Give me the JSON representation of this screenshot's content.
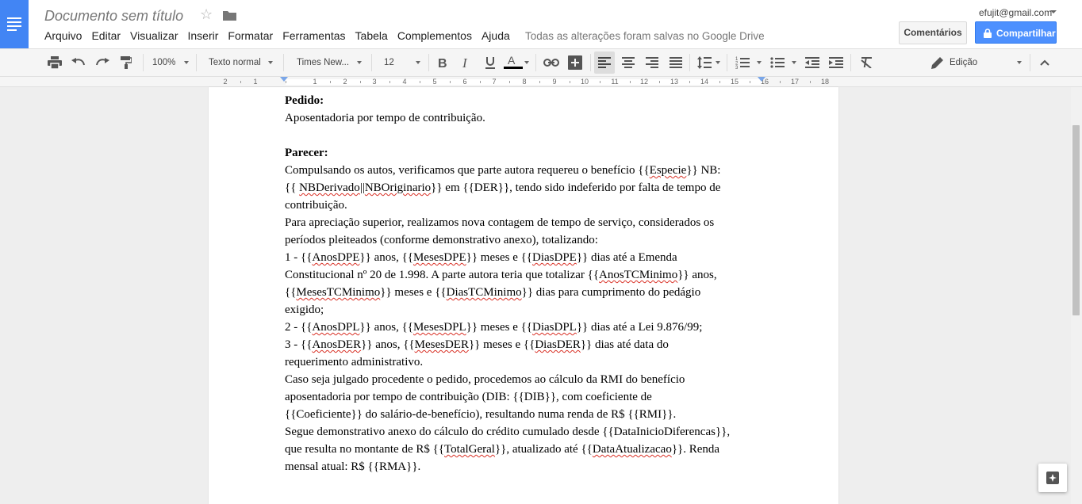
{
  "app": {
    "title": "Documento sem título",
    "save_status": "Todas as alterações foram salvas no Google Drive",
    "account_email": "efujit@gmail.com",
    "brand_color": "#4285f4"
  },
  "menu": [
    "Arquivo",
    "Editar",
    "Visualizar",
    "Inserir",
    "Formatar",
    "Ferramentas",
    "Tabela",
    "Complementos",
    "Ajuda"
  ],
  "header_buttons": {
    "comments": "Comentários",
    "share": "Compartilhar"
  },
  "toolbar": {
    "zoom": "100%",
    "style": "Texto normal",
    "font": "Times New...",
    "size": "12",
    "mode": "Edição",
    "icons": [
      "print-icon",
      "undo-icon",
      "redo-icon",
      "paint-format-icon",
      "bold-icon",
      "italic-icon",
      "underline-icon",
      "text-color-icon",
      "link-icon",
      "comment-icon",
      "align-left-icon",
      "align-center-icon",
      "align-right-icon",
      "justify-icon",
      "line-spacing-icon",
      "numbered-list-icon",
      "bulleted-list-icon",
      "decrease-indent-icon",
      "increase-indent-icon",
      "clear-formatting-icon",
      "pencil-icon",
      "chevron-up-icon"
    ]
  },
  "ruler": {
    "labels": [
      "2",
      "1",
      "1",
      "2",
      "3",
      "4",
      "5",
      "6",
      "7",
      "8",
      "9",
      "10",
      "11",
      "12",
      "13",
      "14",
      "15",
      "16",
      "17",
      "18"
    ]
  },
  "document": {
    "lines": [
      [
        {
          "t": "Pedido:",
          "b": true
        }
      ],
      [
        {
          "t": "Aposentadoria por tempo de contribuição."
        }
      ],
      [],
      [
        {
          "t": "Parecer:",
          "b": true
        }
      ],
      [
        {
          "t": "Compulsando os autos, verificamos que parte autora requereu o benefício {{"
        },
        {
          "t": "Especie",
          "s": true
        },
        {
          "t": "}} NB:"
        }
      ],
      [
        {
          "t": "{{ "
        },
        {
          "t": "NBDerivado",
          "s": true
        },
        {
          "t": "||"
        },
        {
          "t": "NBOriginario",
          "s": true
        },
        {
          "t": "}} em {{DER}}, tendo sido indeferido por falta de tempo de"
        }
      ],
      [
        {
          "t": "contribuição."
        }
      ],
      [
        {
          "t": "Para apreciação superior, realizamos nova contagem de tempo de serviço, considerados os"
        }
      ],
      [
        {
          "t": "períodos pleiteados (conforme demonstrativo anexo), totalizando:"
        }
      ],
      [
        {
          "t": "1 - {{"
        },
        {
          "t": "AnosDPE",
          "s": true
        },
        {
          "t": "}} anos, {{"
        },
        {
          "t": "MesesDPE",
          "s": true
        },
        {
          "t": "}} meses e {{"
        },
        {
          "t": "DiasDPE",
          "s": true
        },
        {
          "t": "}} dias até a Emenda"
        }
      ],
      [
        {
          "t": "Constitucional nº 20 de 1.998. A parte autora teria que totalizar {{"
        },
        {
          "t": "AnosTCMinimo",
          "s": true
        },
        {
          "t": "}} anos,"
        }
      ],
      [
        {
          "t": "{{"
        },
        {
          "t": "MesesTCMinimo",
          "s": true
        },
        {
          "t": "}} meses e {{"
        },
        {
          "t": "DiasTCMinimo",
          "s": true
        },
        {
          "t": "}} dias para cumprimento do pedágio"
        }
      ],
      [
        {
          "t": "exigido;"
        }
      ],
      [
        {
          "t": "2 - {{"
        },
        {
          "t": "AnosDPL",
          "s": true
        },
        {
          "t": "}} anos, {{"
        },
        {
          "t": "MesesDPL",
          "s": true
        },
        {
          "t": "}} meses e {{"
        },
        {
          "t": "DiasDPL",
          "s": true
        },
        {
          "t": "}} dias até a Lei 9.876/99;"
        }
      ],
      [
        {
          "t": "3 - {{"
        },
        {
          "t": "AnosDER",
          "s": true
        },
        {
          "t": "}} anos, {{"
        },
        {
          "t": "MesesDER",
          "s": true
        },
        {
          "t": "}} meses e {{"
        },
        {
          "t": "DiasDER",
          "s": true
        },
        {
          "t": "}} dias até data do"
        }
      ],
      [
        {
          "t": "requerimento administrativo."
        }
      ],
      [
        {
          "t": "Caso seja julgado procedente o pedido, procedemos ao cálculo da RMI do benefício"
        }
      ],
      [
        {
          "t": "aposentadoria por tempo de contribuição (DIB: {{DIB}}, com coeficiente de"
        }
      ],
      [
        {
          "t": "{{Coeficiente}} do salário-de-benefício), resultando numa renda de R$ {{RMI}}."
        }
      ],
      [
        {
          "t": "Segue demonstrativo anexo do cálculo do crédito cumulado desde {{DataInicioDiferencas}},"
        }
      ],
      [
        {
          "t": "que resulta no montante de R$ {{"
        },
        {
          "t": "TotalGeral",
          "s": true
        },
        {
          "t": "}}, atualizado até {{"
        },
        {
          "t": "DataAtualizacao",
          "s": true
        },
        {
          "t": "}}. Renda"
        }
      ],
      [
        {
          "t": "mensal atual: R$ {{RMA}}."
        }
      ]
    ]
  }
}
